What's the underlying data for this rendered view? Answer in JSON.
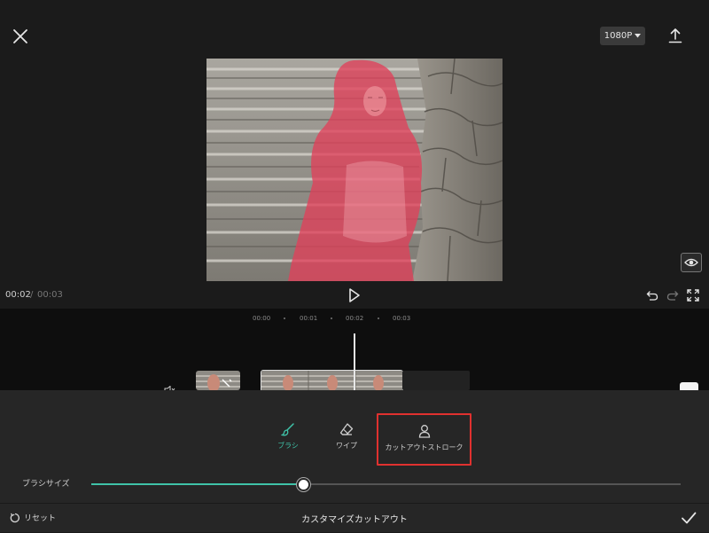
{
  "top_bar": {
    "resolution_label": "1080P",
    "close_icon": "close-icon",
    "export_icon": "export-icon"
  },
  "playback": {
    "current_time": "00:02",
    "separator": "/",
    "total_time": "00:03"
  },
  "timeline": {
    "ticks": [
      "00:00",
      "00:01",
      "00:02",
      "00:03"
    ]
  },
  "tools": {
    "brush_label": "ブラシ",
    "wipe_label": "ワイプ",
    "stroke_label": "カットアウトストローク"
  },
  "brush_size": {
    "label": "ブラシサイズ",
    "value_fraction": 0.36
  },
  "footer": {
    "reset_label": "リセット",
    "title": "カスタマイズカットアウト"
  },
  "colors": {
    "accent": "#3fc2a8",
    "highlight_box": "#e0312f",
    "mask_overlay": "#e0405a"
  }
}
